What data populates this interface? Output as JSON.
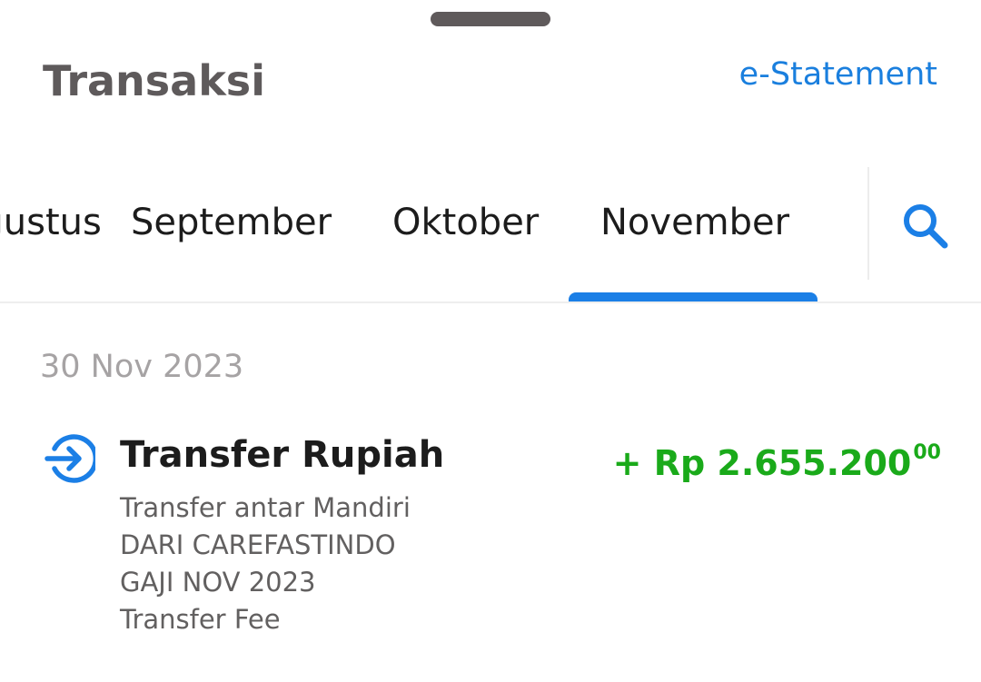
{
  "header": {
    "title": "Transaksi",
    "estatement_label": "e-Statement"
  },
  "tabs": {
    "items": [
      {
        "label": "Agustus",
        "selected": false
      },
      {
        "label": "September",
        "selected": false
      },
      {
        "label": "Oktober",
        "selected": false
      },
      {
        "label": "November",
        "selected": true
      }
    ],
    "search_icon": "search-icon"
  },
  "transactions": {
    "date": "30 Nov 2023",
    "items": [
      {
        "icon": "transfer-in-icon",
        "title": "Transfer Rupiah",
        "amount_main": "+ Rp 2.655.200",
        "amount_cents": "00",
        "details": [
          "Transfer antar Mandiri",
          "DARI CAREFASTINDO",
          "GAJI NOV 2023",
          "Transfer Fee"
        ]
      }
    ]
  },
  "colors": {
    "accent": "#1b7fe6",
    "credit": "#1aaa1a",
    "title": "#5e5a5b",
    "muted": "#a6a3a4"
  }
}
